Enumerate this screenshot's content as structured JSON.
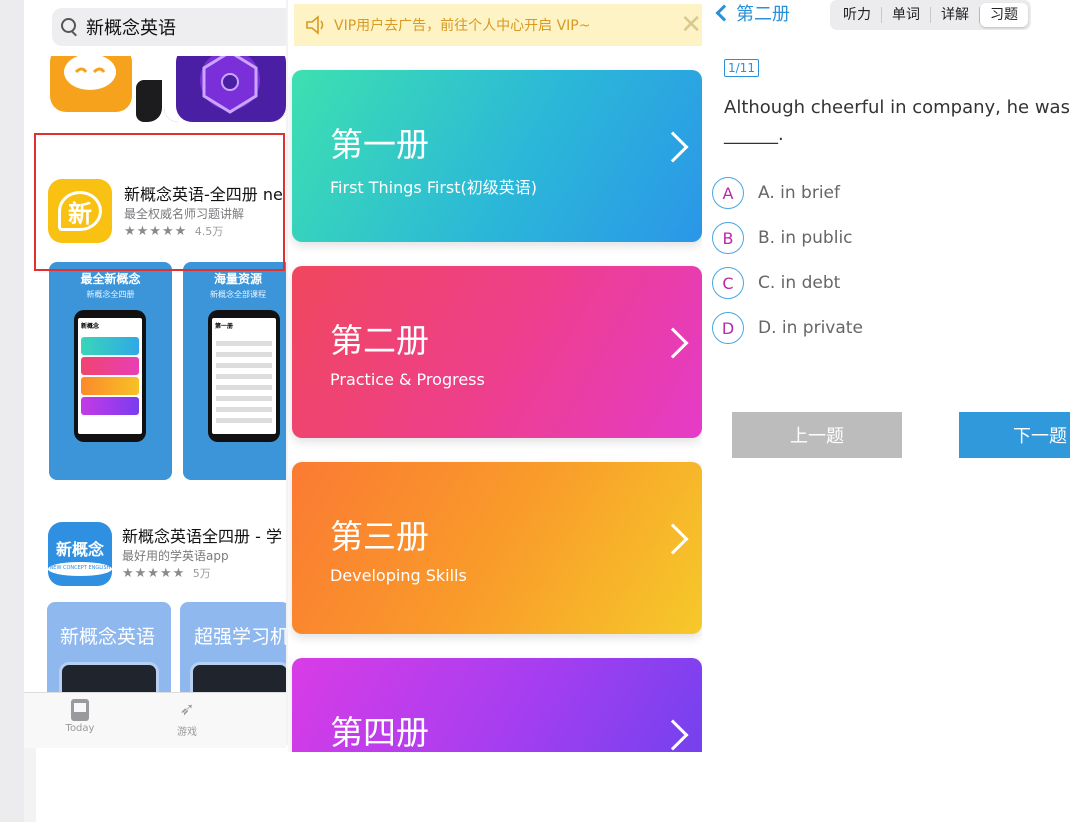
{
  "left": {
    "search_query": "新概念英语",
    "app1": {
      "icon_text": "新",
      "name": "新概念英语-全四册 ne",
      "subtitle": "最全权威名师习题讲解",
      "stars": "★★★★★",
      "rating_count": "4.5万"
    },
    "shot1": {
      "title": "最全新概念",
      "sub": "新概念全四册",
      "screen_title": "新概念"
    },
    "shot2": {
      "title": "海量资源",
      "sub": "新概念全部课程",
      "screen_title": "第一册"
    },
    "app2": {
      "icon_text": "新概念",
      "icon_sub": "NEW CONCEPT ENGLISH",
      "name": "新概念英语全四册 - 学",
      "subtitle": "最好用的学英语app",
      "stars": "★★★★★",
      "rating_count": "5万"
    },
    "promo1": "新概念英语",
    "promo2": "超强学习机",
    "tabs": {
      "today": "Today",
      "games": "游戏"
    }
  },
  "middle": {
    "vip_banner": "VIP用户去广告，前往个人中心开启 VIP~",
    "books": [
      {
        "title": "第一册",
        "subtitle": "First Things First(初级英语)"
      },
      {
        "title": "第二册",
        "subtitle": "Practice & Progress"
      },
      {
        "title": "第三册",
        "subtitle": "Developing Skills"
      },
      {
        "title": "第四册",
        "subtitle": ""
      }
    ]
  },
  "right": {
    "back_label": "第二册",
    "tabs": [
      "听力",
      "单词",
      "详解",
      "习题"
    ],
    "active_tab": "习题",
    "counter": "1/11",
    "question": "Although cheerful in company, he was of",
    "blank": "______.",
    "options": [
      {
        "letter": "A",
        "text": "A. in brief"
      },
      {
        "letter": "B",
        "text": "B. in public"
      },
      {
        "letter": "C",
        "text": "C. in debt"
      },
      {
        "letter": "D",
        "text": "D. in private"
      }
    ],
    "prev_label": "上一题",
    "next_label": "下一题"
  },
  "colors": {
    "accent_blue": "#2a90d9",
    "highlight_red": "#e03131",
    "vip_text": "#d89a23",
    "prev_button": "#bcbcbc",
    "next_button": "#2f99dc"
  }
}
